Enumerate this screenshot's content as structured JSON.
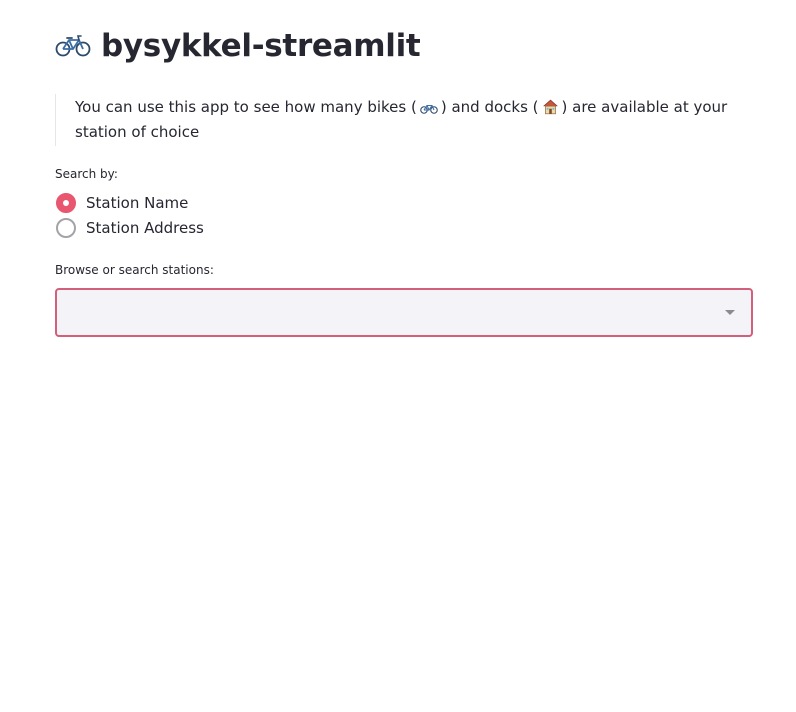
{
  "header": {
    "emoji": "bicycle-emoji",
    "title": "bysykkel-streamlit"
  },
  "intro": {
    "text_part1": "You can use this app to see how many bikes (",
    "bike_emoji": "bicycle-emoji",
    "text_part2": ") and docks (",
    "dock_emoji": "house-emoji",
    "text_part3": ") are available at your station of choice"
  },
  "search_by": {
    "label": "Search by:",
    "options": [
      {
        "label": "Station Name",
        "checked": true
      },
      {
        "label": "Station Address",
        "checked": false
      }
    ]
  },
  "station_select": {
    "label": "Browse or search stations:",
    "value": "",
    "icon": "chevron-down-icon"
  },
  "colors": {
    "accent": "#e8566f",
    "select_border": "#d3607a",
    "select_bg": "#f4f3f7",
    "text": "#262730"
  }
}
